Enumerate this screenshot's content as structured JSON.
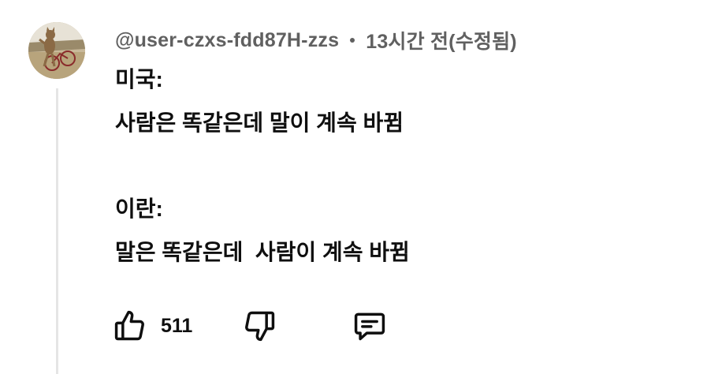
{
  "comment": {
    "author_handle": "@user-czxs-fdd87H-zzs",
    "separator": "•",
    "timestamp": "13시간 전(수정됨)",
    "lines": [
      "미국:",
      "사람은 똑같은데 말이 계속 바뀜",
      "",
      "이란:",
      "말은 똑같은데  사람이 계속 바뀜"
    ]
  },
  "actions": {
    "like_count": "511",
    "like_icon": "thumbs-up-icon",
    "dislike_icon": "thumbs-down-icon",
    "reply_icon": "comment-icon"
  },
  "colors": {
    "text_primary": "#0f0f0f",
    "text_secondary": "#606060",
    "thread_line": "#e5e5e5"
  }
}
